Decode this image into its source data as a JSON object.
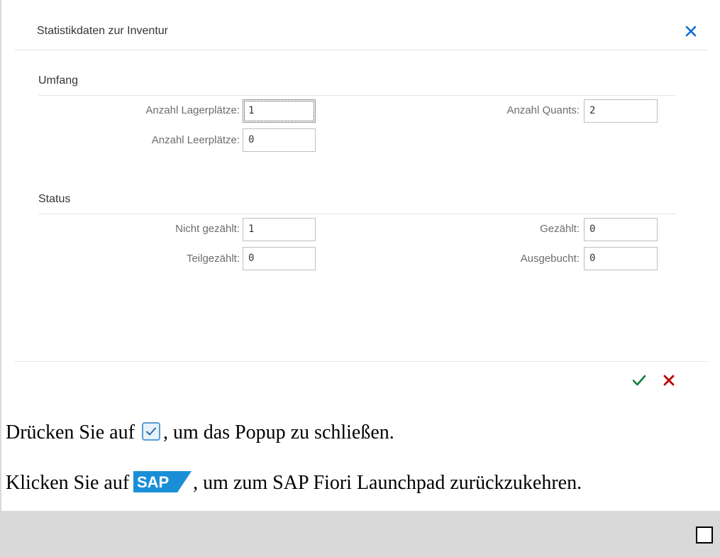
{
  "dialog": {
    "title": "Statistikdaten zur Inventur"
  },
  "sections": {
    "umfang": {
      "title": "Umfang",
      "fields": {
        "anzahl_lagerplaetze": {
          "label": "Anzahl Lagerplätze:",
          "value": "1"
        },
        "anzahl_quants": {
          "label": "Anzahl Quants:",
          "value": "2"
        },
        "anzahl_leerplaetze": {
          "label": "Anzahl Leerplätze:",
          "value": "0"
        }
      }
    },
    "status": {
      "title": "Status",
      "fields": {
        "nicht_gezaehlt": {
          "label": "Nicht gezählt:",
          "value": "1"
        },
        "gezaehlt": {
          "label": "Gezählt:",
          "value": "0"
        },
        "teilgezaehlt": {
          "label": "Teilgezählt:",
          "value": "0"
        },
        "ausgebucht": {
          "label": "Ausgebucht:",
          "value": "0"
        }
      }
    }
  },
  "instructions": {
    "line1_before": "Drücken Sie auf",
    "line1_after": ", um das Popup zu schließen.",
    "line2_before": "Klicken Sie auf",
    "line2_after": ", um zum SAP Fiori Launchpad zurückzukehren.",
    "sap_logo_text": "SAP"
  },
  "colors": {
    "close_icon": "#0a6ed1",
    "confirm_icon": "#107e3e",
    "cancel_icon": "#bb0000",
    "sap_blue": "#1a8fd8"
  }
}
